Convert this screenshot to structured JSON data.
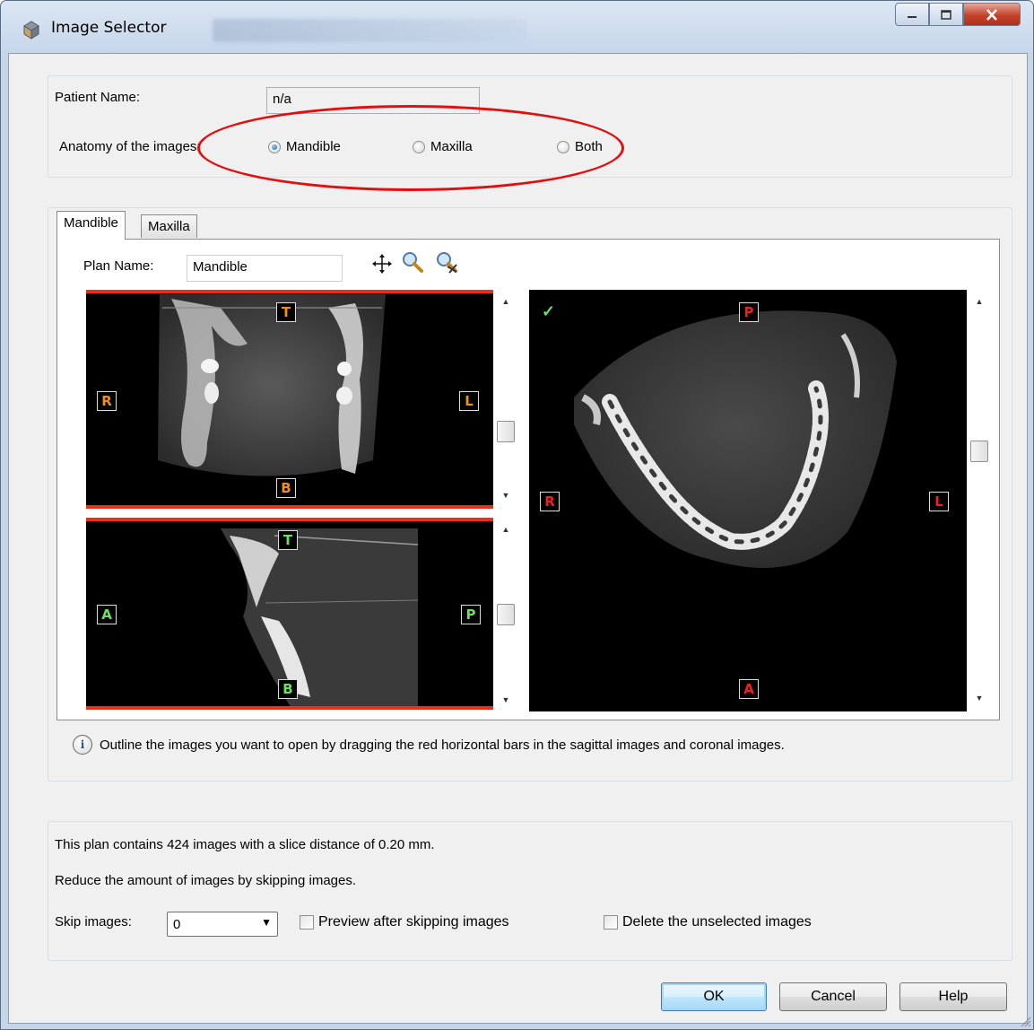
{
  "window": {
    "title": "Image Selector"
  },
  "patient": {
    "name_label": "Patient Name:",
    "name_value": "n/a"
  },
  "anatomy": {
    "label": "Anatomy of the images:",
    "options": [
      "Mandible",
      "Maxilla",
      "Both"
    ],
    "selected": "Mandible"
  },
  "tabs": {
    "items": [
      "Mandible",
      "Maxilla"
    ],
    "active": "Mandible"
  },
  "plan": {
    "name_label": "Plan Name:",
    "name_value": "Mandible"
  },
  "viewers": {
    "coronal": {
      "top": "T",
      "bottom": "B",
      "left": "R",
      "right": "L"
    },
    "sagittal": {
      "top": "T",
      "bottom": "B",
      "left": "A",
      "right": "P"
    },
    "axial": {
      "top": "P",
      "bottom": "A",
      "left": "R",
      "right": "L",
      "check": "✓"
    }
  },
  "info": {
    "text": "Outline the images you want to open by dragging the red horizontal bars in the sagittal images and coronal images."
  },
  "slices": {
    "summary": "This plan contains 424 images with a slice distance of 0.20 mm.",
    "hint": "Reduce the amount of images by skipping images.",
    "skip_label": "Skip images:",
    "skip_value": "0",
    "preview_label": "Preview after skipping images",
    "delete_label": "Delete the unselected images"
  },
  "buttons": {
    "ok": "OK",
    "cancel": "Cancel",
    "help": "Help"
  },
  "colors": {
    "highlight_ellipse": "#e01010",
    "bar_red": "#e8301a",
    "marker_orange": "#f0901c",
    "marker_green": "#6ee060",
    "marker_red": "#f02020"
  }
}
